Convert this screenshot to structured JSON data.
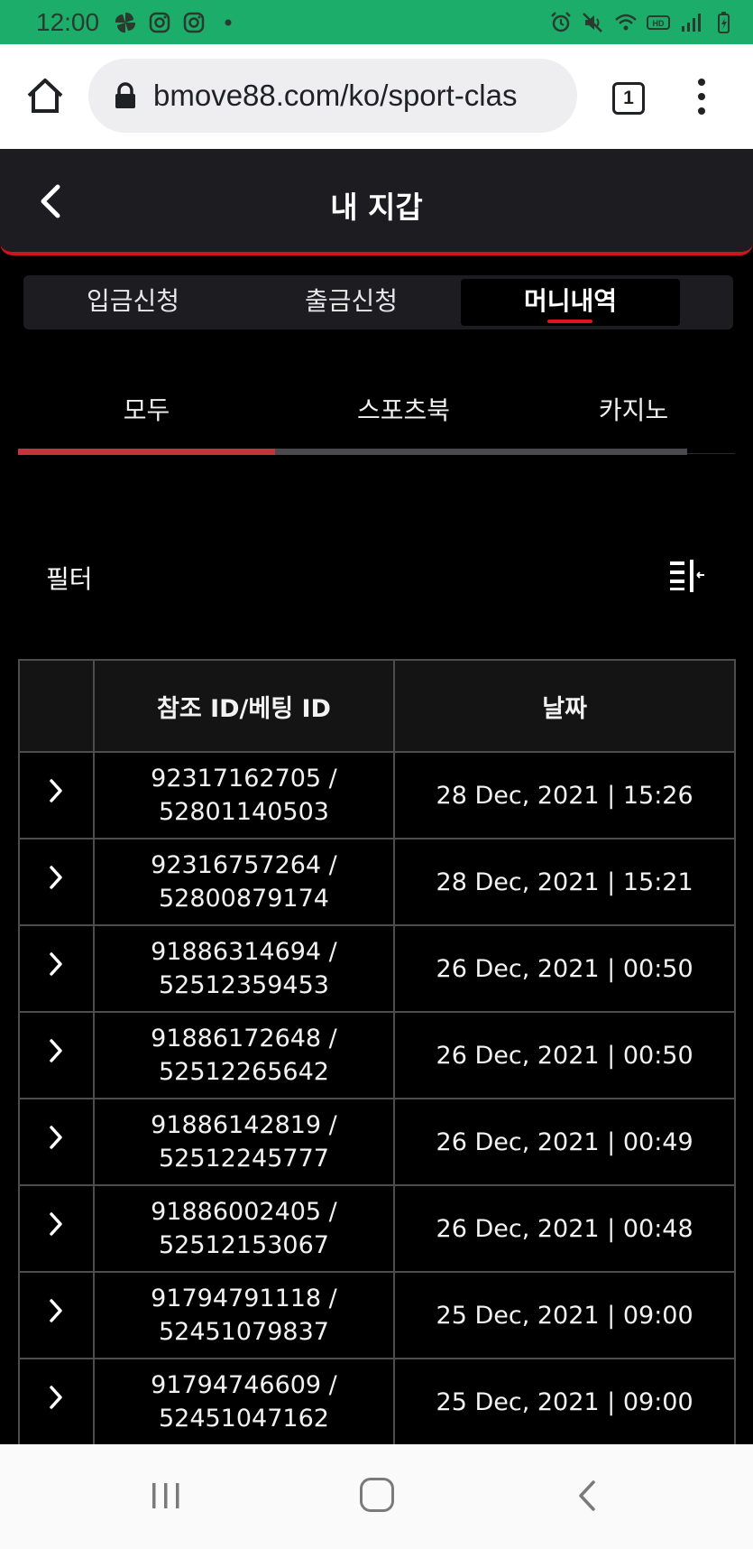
{
  "status_bar": {
    "time": "12:00",
    "left_icons": [
      "pinwheel-icon",
      "instagram-icon",
      "instagram-icon",
      "dot-icon"
    ],
    "right_icons": [
      "alarm-icon",
      "mute-icon",
      "wifi-icon",
      "hd-icon",
      "signal-icon",
      "battery-icon"
    ]
  },
  "browser": {
    "url": "bmove88.com/ko/sport-clas",
    "tab_count": "1"
  },
  "header": {
    "title": "내 지갑"
  },
  "top_tabs": [
    {
      "label": "입금신청",
      "active": false
    },
    {
      "label": "출금신청",
      "active": false
    },
    {
      "label": "머니내역",
      "active": true
    }
  ],
  "sub_tabs": [
    {
      "label": "모두",
      "active": true
    },
    {
      "label": "스포츠북",
      "active": false
    },
    {
      "label": "카지노",
      "active": false
    }
  ],
  "filter": {
    "label": "필터"
  },
  "table": {
    "headers": [
      "",
      "참조 ID/베팅 ID",
      "날짜"
    ],
    "rows": [
      {
        "ref_id": "92317162705 /",
        "bet_id": "52801140503",
        "date": "28 Dec, 2021 | 15:26"
      },
      {
        "ref_id": "92316757264 /",
        "bet_id": "52800879174",
        "date": "28 Dec, 2021 | 15:21"
      },
      {
        "ref_id": "91886314694 /",
        "bet_id": "52512359453",
        "date": "26 Dec, 2021 | 00:50"
      },
      {
        "ref_id": "91886172648 /",
        "bet_id": "52512265642",
        "date": "26 Dec, 2021 | 00:50"
      },
      {
        "ref_id": "91886142819 /",
        "bet_id": "52512245777",
        "date": "26 Dec, 2021 | 00:49"
      },
      {
        "ref_id": "91886002405 /",
        "bet_id": "52512153067",
        "date": "26 Dec, 2021 | 00:48"
      },
      {
        "ref_id": "91794791118 /",
        "bet_id": "52451079837",
        "date": "25 Dec, 2021 | 09:00"
      },
      {
        "ref_id": "91794746609 /",
        "bet_id": "52451047162",
        "date": "25 Dec, 2021 | 09:00"
      }
    ]
  },
  "colors": {
    "status_bar": "#1dad6a",
    "accent_red": "#d1141b",
    "header_bg": "#1c1c21",
    "page_bg": "#000000"
  }
}
